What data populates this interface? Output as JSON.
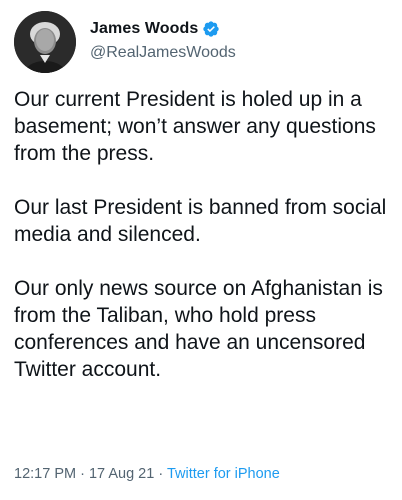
{
  "author": {
    "display_name": "James Woods",
    "handle": "@RealJamesWoods",
    "verified_icon": "verified-badge-icon",
    "verified_color": "#1d9bf0"
  },
  "tweet": {
    "paragraphs": [
      "Our current President is holed up in a basement; won’t answer any questions from the press.",
      "Our last President is banned from social media and silenced.",
      "Our only news source on Afghanistan is from the Taliban, who hold press conferences and have an uncensored Twitter account."
    ],
    "time": "12:17 PM",
    "date": "17 Aug 21",
    "separator": "·",
    "source": "Twitter for iPhone"
  },
  "colors": {
    "text": "#0f1419",
    "secondary": "#536471",
    "accent": "#1d9bf0"
  }
}
